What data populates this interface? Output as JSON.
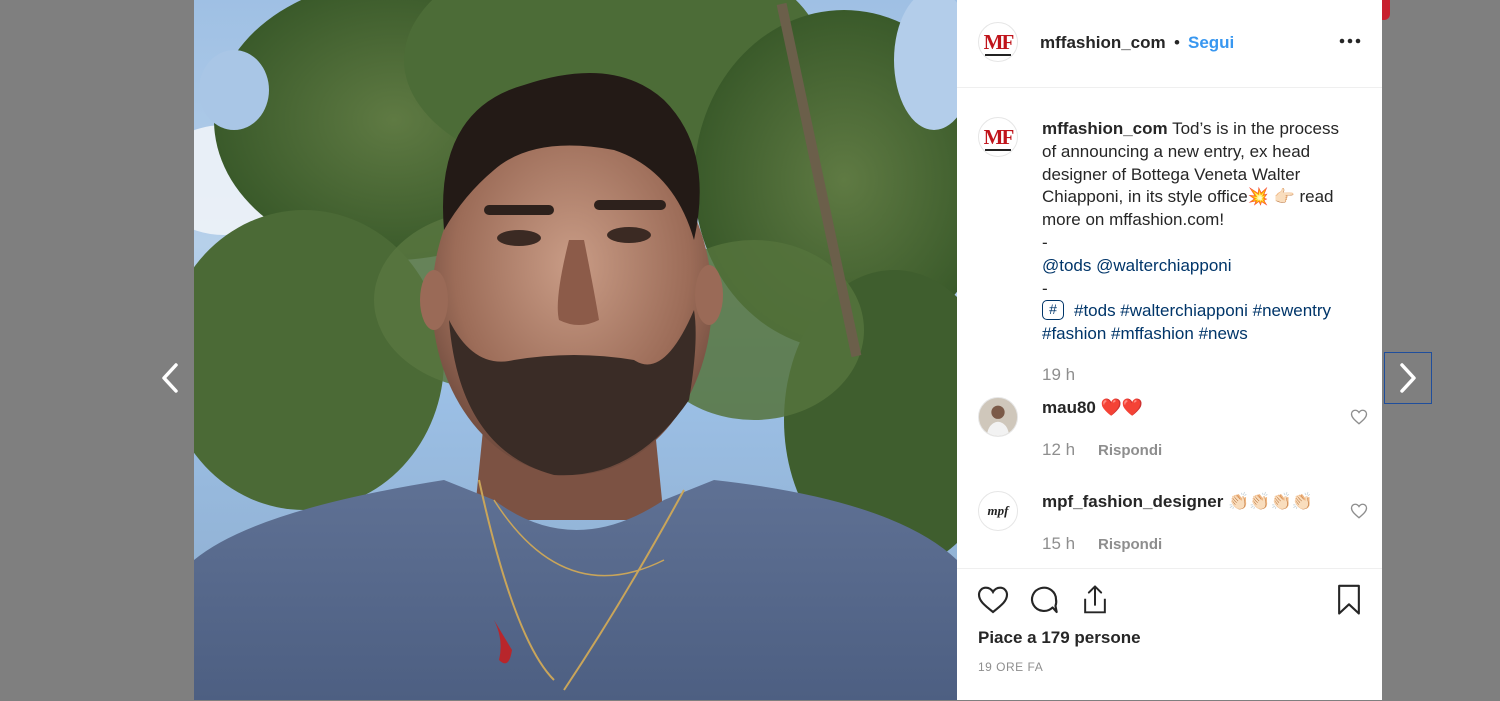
{
  "post": {
    "author": "mffashion_com",
    "dot": "•",
    "follow_label": "Segui",
    "caption_line1": "Tod’s is in the process",
    "caption_line2": "of announcing a new entry, ex head",
    "caption_line3": "designer of Bottega Veneta Walter",
    "caption_line4a": "Chiapponi, in its style office💥 👉🏻 read",
    "caption_line5": "more on mffashion.com!",
    "dash1": "-",
    "mentions": "@tods @walterchiapponi",
    "dash2": "-",
    "hash_icon": "#",
    "hashtags_line1": "#tods #walterchiapponi #newentry",
    "hashtags_line2": "#fashion #mffashion #news",
    "caption_time": "19 h",
    "likes_text": "Piace a 179 persone",
    "date_text": "19 ORE FA"
  },
  "comments": [
    {
      "user": "mau80",
      "text": "❤️❤️",
      "time": "12 h",
      "reply_label": "Rispondi"
    },
    {
      "user": "mpf_fashion_designer",
      "text": "👏🏻👏🏻👏🏻👏🏻",
      "time": "15 h",
      "reply_label": "Rispondi"
    }
  ],
  "logo": {
    "brand_initials": "MF",
    "mpf_initials": "mpf"
  },
  "icons": {
    "prev": "chevron-left-icon",
    "next": "chevron-right-icon",
    "more": "more-horizontal-icon",
    "like": "heart-icon",
    "comment": "comment-icon",
    "share": "share-icon",
    "save": "bookmark-icon"
  },
  "colors": {
    "link": "#003569",
    "follow": "#3897f0",
    "brand_red": "#c0141b",
    "secondary": "#8e8e8e"
  }
}
